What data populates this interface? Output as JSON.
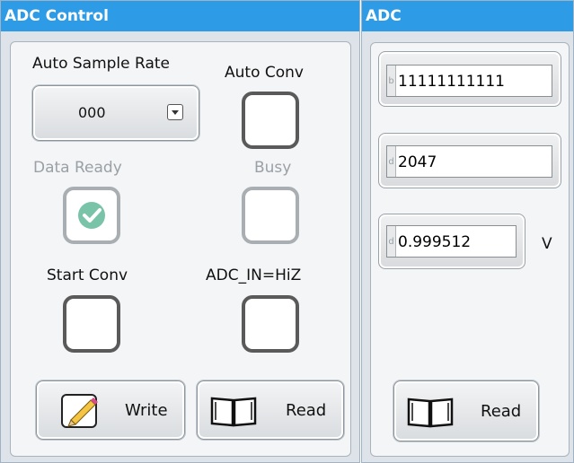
{
  "adc_control": {
    "title": "ADC Control",
    "auto_sample_rate": {
      "label": "Auto Sample Rate",
      "value": "000"
    },
    "auto_conv": {
      "label": "Auto Conv"
    },
    "data_ready": {
      "label": "Data Ready",
      "checked": true
    },
    "busy": {
      "label": "Busy"
    },
    "start_conv": {
      "label": "Start Conv"
    },
    "adc_in_hiz": {
      "label": "ADC_IN=HiZ"
    },
    "write_button": "Write",
    "read_button": "Read"
  },
  "adc": {
    "title": "ADC",
    "binary": {
      "radix": "b",
      "value": "11111111111"
    },
    "decimal": {
      "radix": "d",
      "value": "2047"
    },
    "voltage": {
      "radix": "d",
      "value": "0.999512",
      "unit": "V"
    },
    "read_button": "Read"
  },
  "colors": {
    "title_bar": "#2d9be6",
    "panel_bg": "#dde3e8",
    "check_green": "#79c3a8"
  },
  "icons": [
    "dropdown-arrow-icon",
    "checkmark-icon",
    "pencil-notepad-icon",
    "open-book-icon"
  ]
}
